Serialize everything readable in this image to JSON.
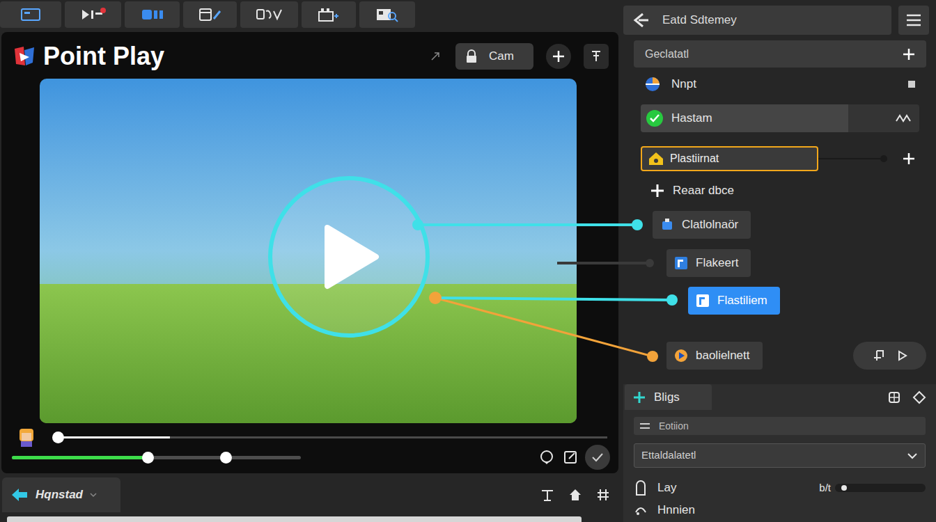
{
  "app": {
    "title": "Point Play"
  },
  "player": {
    "cam_button": "Cam",
    "progress": {
      "level": 0.21
    },
    "volume": {
      "level": 0.47,
      "marker_level": 0.74
    }
  },
  "bottom_bar": {
    "tab": "Hqnstad"
  },
  "panel": {
    "title": "Eatd Sdtemey",
    "items": [
      {
        "label": "Geclatatl",
        "kind": "header",
        "selected": false,
        "checked": false
      },
      {
        "label": "Nnpt",
        "kind": "plain",
        "selected": false,
        "checked": false
      },
      {
        "label": "Hastam",
        "kind": "check",
        "selected": false,
        "checked": true
      },
      {
        "label": "Plastiirnat",
        "kind": "field",
        "selected": false,
        "checked": false
      },
      {
        "label": "Reaar dbce",
        "kind": "add",
        "selected": false,
        "checked": false
      },
      {
        "label": "Clatlolnaör",
        "kind": "node",
        "selected": false,
        "checked": false
      },
      {
        "label": "Flakeert",
        "kind": "node",
        "selected": false,
        "checked": false
      },
      {
        "label": "Flastiliem",
        "kind": "node",
        "selected": true,
        "checked": false
      },
      {
        "label": "baolielnett",
        "kind": "node-actions",
        "selected": false,
        "checked": false
      }
    ]
  },
  "section": {
    "tab": "Bligs",
    "field": "Eotiion",
    "dropdown": "Ettaldalatetl",
    "rows": [
      {
        "label": "Lay",
        "kind": "slider",
        "value": "b/t",
        "level": 0.05
      },
      {
        "label": "Hnnien",
        "kind": "plain"
      }
    ]
  }
}
